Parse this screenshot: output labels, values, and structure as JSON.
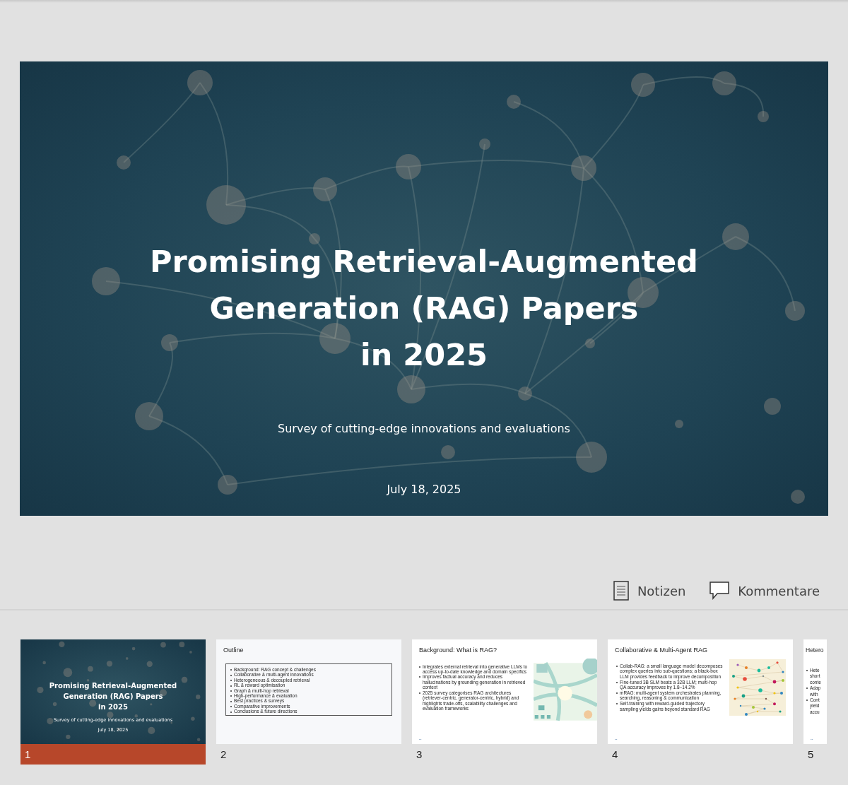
{
  "main_slide": {
    "title_lines": [
      "Promising Retrieval-Augmented",
      "Generation (RAG) Papers",
      "in 2025"
    ],
    "subtitle": "Survey of cutting-edge innovations and evaluations",
    "date": "July 18, 2025"
  },
  "toolbar": [
    {
      "kind": "notes",
      "label": "Notizen"
    },
    {
      "kind": "comments",
      "label": "Kommentare"
    }
  ],
  "thumbnails": [
    {
      "number": "1",
      "selected": true,
      "kind": "title",
      "title_lines": [
        "Promising Retrieval-Augmented",
        "Generation (RAG) Papers",
        "in 2025"
      ],
      "subtitle": "Survey of cutting-edge innovations and evaluations",
      "date": "July 18, 2025"
    },
    {
      "number": "2",
      "selected": false,
      "kind": "outline",
      "title": "Outline",
      "bullets": [
        "Background: RAG concept & challenges",
        "Collaborative & multi-agent innovations",
        "Heterogeneous & decoupled retrieval",
        "RL & reward optimisation",
        "Graph & multi-hop retrieval",
        "High-performance & evaluation",
        "Best practices & surveys",
        "Comparative improvements",
        "Conclusions & future directions"
      ]
    },
    {
      "number": "3",
      "selected": false,
      "kind": "content",
      "title": "Background: What is RAG?",
      "bullets": [
        "Integrates external retrieval into generative LLMs to access up-to-date knowledge and domain specifics",
        "Improves factual accuracy and reduces hallucinations by grounding generation in retrieved context",
        "2025 survey categorises RAG architectures (retriever-centric, generator-centric, hybrid) and highlights trade-offs, scalability challenges and evaluation frameworks"
      ],
      "footer": "--"
    },
    {
      "number": "4",
      "selected": false,
      "kind": "content",
      "title": "Collaborative & Multi-Agent RAG",
      "bullets": [
        "Collab-RAG: a small language model decomposes complex queries into sub-questions; a black-box LLM provides feedback to improve decomposition",
        "Fine-tuned 3B SLM beats a 32B LLM; multi-hop QA accuracy improves by 1.8–14.2%",
        "mRAG: multi-agent system orchestrates planning, searching, reasoning & communication",
        "Self-training with reward-guided trajectory sampling yields gains beyond standard RAG"
      ],
      "footer": "--"
    },
    {
      "number": "5",
      "selected": false,
      "kind": "partial",
      "title": "Hetero",
      "bullet_lines": [
        [
          "Hete",
          "short",
          "conte"
        ],
        [
          "Adap",
          "with"
        ],
        [
          "Cont",
          "yield",
          "accu"
        ]
      ],
      "footer": "--"
    }
  ]
}
